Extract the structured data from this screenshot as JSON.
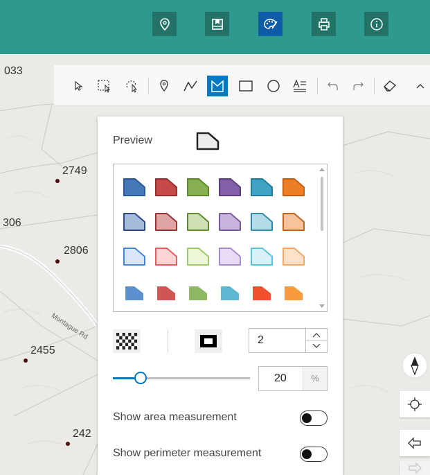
{
  "map": {
    "labels": [
      "033",
      "2749",
      "306",
      "2806",
      "2455",
      "242"
    ],
    "road_label": "Montague Rd"
  },
  "topbar": {
    "buttons": [
      {
        "icon": "location-pin-icon",
        "active": false
      },
      {
        "icon": "bookmark-icon",
        "active": false
      },
      {
        "icon": "palette-icon",
        "active": true
      },
      {
        "icon": "printer-icon",
        "active": false
      },
      {
        "icon": "info-icon",
        "active": false
      }
    ],
    "accent_color": "#2e9a8f",
    "active_color": "#0e5ca8"
  },
  "sketch_toolbar": {
    "tools": [
      "select-icon",
      "rectangle-select-icon",
      "lasso-select-icon",
      "point-icon",
      "polyline-icon",
      "polygon-icon",
      "rectangle-icon",
      "circle-icon",
      "text-icon",
      "undo-icon",
      "redo-icon",
      "eraser-icon",
      "collapse-icon"
    ],
    "active_tool": "polygon-icon",
    "active_color": "#0079c1"
  },
  "panel": {
    "preview_label": "Preview",
    "fill_opacity_icon": "checkerboard-icon",
    "outline_icon": "outline-square-icon",
    "outline_width": "2",
    "opacity_value": "20",
    "opacity_unit": "%",
    "opacity_fraction": 0.2,
    "show_area_label": "Show area measurement",
    "show_perimeter_label": "Show perimeter measurement",
    "show_area_enabled": false,
    "show_perimeter_enabled": false
  },
  "symbol_colors": {
    "row1": [
      [
        "#4778b7",
        "#2b5896"
      ],
      [
        "#c44a4a",
        "#9a2f2f"
      ],
      [
        "#87b051",
        "#5d8a2c"
      ],
      [
        "#8260a8",
        "#5d3f82"
      ],
      [
        "#3ea3c4",
        "#237b9a"
      ],
      [
        "#ec7e28",
        "#c45d0f"
      ]
    ],
    "row2": [
      [
        "#a5bcdd",
        "#2e4d84"
      ],
      [
        "#e0a6a6",
        "#9a3535"
      ],
      [
        "#cfe0b5",
        "#5e8a2f"
      ],
      [
        "#c7b4dc",
        "#7a5a9e"
      ],
      [
        "#b3dbe8",
        "#2f8aa7"
      ],
      [
        "#f7c39c",
        "#c0651e"
      ]
    ],
    "row3": [
      [
        "#d9e6f8",
        "#4a86d8"
      ],
      [
        "#fbd5d5",
        "#e06060"
      ],
      [
        "#ecf7d8",
        "#9cc96b"
      ],
      [
        "#e7dcf4",
        "#a78ad3"
      ],
      [
        "#d8f1f8",
        "#5bc2dd"
      ],
      [
        "#fde1c8",
        "#f0a76a"
      ]
    ],
    "row4": [
      "#5b8fd0",
      "#d05656",
      "#8fb864",
      "#5cb8d0",
      "#f0502e",
      "#f79a3e"
    ]
  },
  "side_buttons": [
    "compass-icon",
    "locate-icon",
    "back-arrow-icon"
  ]
}
